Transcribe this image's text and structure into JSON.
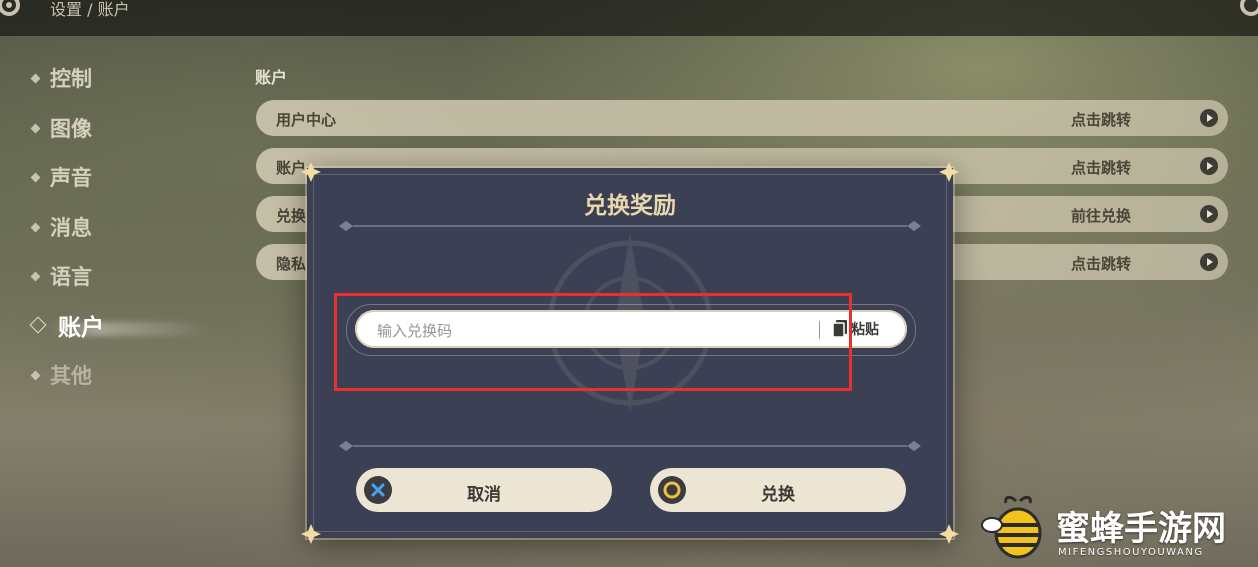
{
  "header": {
    "breadcrumb": "设置 / 账户"
  },
  "sidebar": {
    "items": [
      {
        "label": "控制"
      },
      {
        "label": "图像"
      },
      {
        "label": "声音"
      },
      {
        "label": "消息"
      },
      {
        "label": "语言"
      },
      {
        "label": "账户",
        "active": true
      },
      {
        "label": "其他"
      }
    ]
  },
  "main": {
    "section_title": "账户",
    "rows": [
      {
        "label": "用户中心",
        "action": "点击跳转"
      },
      {
        "label": "账户",
        "action": "点击跳转"
      },
      {
        "label": "兑换",
        "action": "前往兑换"
      },
      {
        "label": "隐私",
        "action": "点击跳转"
      }
    ]
  },
  "dialog": {
    "title": "兑换奖励",
    "input": {
      "placeholder": "输入兑换码",
      "value": ""
    },
    "paste_label": "粘贴",
    "cancel_label": "取消",
    "confirm_label": "兑换"
  },
  "watermark": {
    "text": "蜜蜂手游网",
    "subtext": "MIFENGSHOUYOUWANG"
  },
  "colors": {
    "dialog_bg": "#3b4054",
    "title_gold": "#e9d8ad",
    "highlight": "#e8312f",
    "button_bg": "#ece5d3",
    "cancel_icon": "#3d8ed6",
    "confirm_icon": "#e8b53a"
  }
}
